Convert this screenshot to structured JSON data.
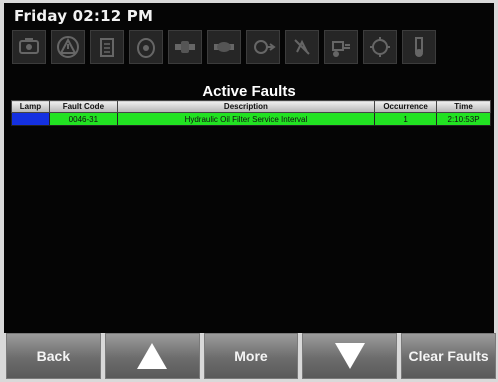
{
  "header": {
    "clock": "Friday 02:12 PM"
  },
  "status_icons": [
    {
      "icon": "engine-warning-icon"
    },
    {
      "icon": "warning-triangle-icon"
    },
    {
      "icon": "fuel-filter-icon"
    },
    {
      "icon": "oil-drop-icon"
    },
    {
      "icon": "pipe-connector-icon"
    },
    {
      "icon": "pipe-connector-icon"
    },
    {
      "icon": "hydraulic-icon"
    },
    {
      "icon": "no-spray-icon"
    },
    {
      "icon": "tractor-icon"
    },
    {
      "icon": "gear-tooth-icon"
    },
    {
      "icon": "coolant-icon"
    }
  ],
  "panel": {
    "title": "Active Faults",
    "columns": [
      "Lamp",
      "Fault Code",
      "Description",
      "Occurrence",
      "Time"
    ],
    "rows": [
      {
        "lamp_color": "#1430e0",
        "fault_code": "0046-31",
        "description": "Hydraulic Oil Filter Service Interval",
        "occurrence": "1",
        "time": "2:10:53P"
      }
    ]
  },
  "softkeys": {
    "back": "Back",
    "up": "up-arrow-icon",
    "more": "More",
    "down": "down-arrow-icon",
    "clear": "Clear Faults"
  },
  "colors": {
    "row_highlight": "#22e222",
    "lamp": "#1430e0",
    "screen_bg": "#050505"
  }
}
